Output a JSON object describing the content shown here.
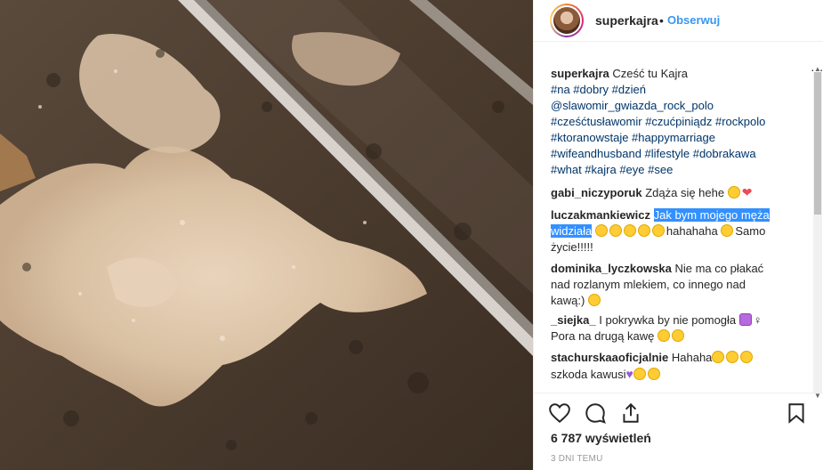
{
  "post": {
    "username": "superkajra",
    "separator": "•",
    "follow_label": "Obserwuj",
    "more_label": "...",
    "caption_text": "Cześć tu Kajra",
    "caption_lines": [
      "#na #dobry #dzień",
      "@slawomir_gwiazda_rock_polo",
      "#cześćtusławomir #czućpiniądz #rockpolo",
      "#ktoranowstaje #happymarriage",
      "#wifeandhusband #lifestyle #dobrakawa",
      "#what #kajra #eye #see"
    ]
  },
  "comments": [
    {
      "user": "gabi_niczyporuk",
      "text": "Zdąża się hehe"
    },
    {
      "user": "luczakmankiewicz",
      "highlight1": "Jak bym mojego męża",
      "highlight2": "widziała",
      "text": "hahahaha",
      "text2": "Samo",
      "text3": "życie!!!!!"
    },
    {
      "user": "dominika_lyczkowska",
      "text": "Nie ma co płakać",
      "text2": "nad rozlanym mlekiem, co innego nad",
      "text3": "kawą:)"
    },
    {
      "user": "_siejka_",
      "text": "I pokrywka by nie pomogła",
      "sign": "♀",
      "text2": "Pora na drugą kawę"
    },
    {
      "user": "stachurskaaoficjalnie",
      "text": "Hahaha",
      "text2": "szkoda kawusi"
    }
  ],
  "stats": {
    "views": "6 787 wyświetleń",
    "time": "3 DNI TEMU"
  },
  "icons": {
    "like": "heart-icon",
    "comment": "comment-icon",
    "share": "share-icon",
    "save": "bookmark-icon"
  }
}
